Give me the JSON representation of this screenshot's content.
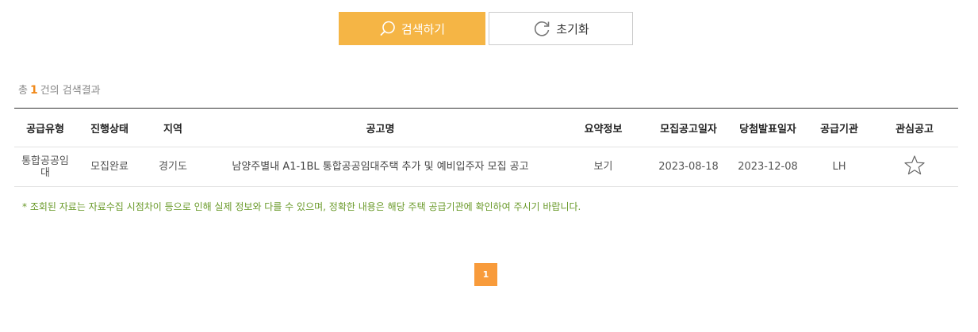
{
  "buttons": {
    "search_label": "검색하기",
    "reset_label": "초기화"
  },
  "summary": {
    "prefix": "총",
    "count": "1",
    "suffix": "건의 검색결과"
  },
  "table": {
    "headers": [
      "공급유형",
      "진행상태",
      "지역",
      "공고명",
      "요약정보",
      "모집공고일자",
      "당첨발표일자",
      "공급기관",
      "관심공고"
    ],
    "rows": [
      {
        "supply_type": "통합공공임대",
        "status": "모집완료",
        "region": "경기도",
        "title": "남양주별내 A1-1BL 통합공공임대주택 추가 및 예비입주자 모집 공고",
        "summary_link": "보기",
        "notice_date": "2023-08-18",
        "winner_date": "2023-12-08",
        "agency": "LH"
      }
    ]
  },
  "notice": "* 조회된 자료는 자료수집 시점차이 등으로 인해 실제 정보와 다를 수 있으며, 정확한 내용은 해당 주택 공급기관에 확인하여 주시기 바랍니다.",
  "pagination": {
    "current": "1"
  },
  "colors": {
    "accent": "#f5b545",
    "count": "#f08a1c",
    "notice": "#6a9a2a",
    "page": "#f89b3b"
  },
  "icons": {
    "search": "search-icon",
    "reset": "refresh-icon",
    "favorite": "star-outline-icon"
  }
}
